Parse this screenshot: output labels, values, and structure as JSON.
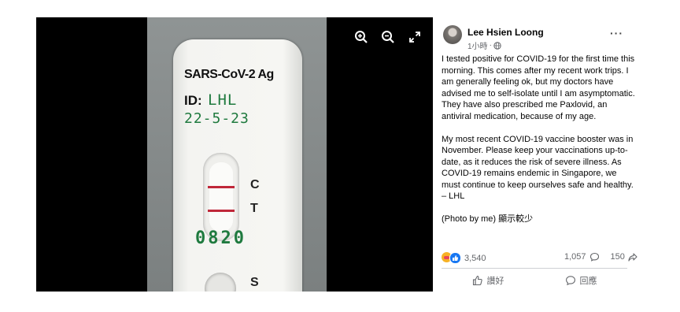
{
  "viewer": {
    "controls": [
      {
        "name": "zoom-in-icon",
        "label": "Zoom in"
      },
      {
        "name": "zoom-out-icon",
        "label": "Zoom out"
      },
      {
        "name": "fullscreen-icon",
        "label": "Full screen"
      }
    ],
    "photo": {
      "brand_text": "SARS-CoV-2 Ag",
      "id_label": "ID:",
      "id_handwritten": "LHL",
      "date_handwritten": "22-5-23",
      "marker_c": "C",
      "marker_t": "T",
      "number_handwritten": "0820",
      "marker_s": "S",
      "line_color": "#c0283a",
      "ink_color": "#1f7a3f"
    }
  },
  "post": {
    "author": "Lee Hsien Loong",
    "timestamp": "1小時",
    "privacy_icon": "globe-icon",
    "paragraphs": [
      "I tested positive for COVID-19 for the first time this morning. This comes after my recent work trips. I am generally feeling ok, but my doctors have advised me to self-isolate until I am asymptomatic. They have also prescribed me Paxlovid, an antiviral medication, because of my age.",
      "My most recent COVID-19 vaccine booster was in November. Please keep your vaccinations up-to-date, as it reduces the risk of severe illness. As COVID-19 remains endemic in Singapore, we must continue to keep ourselves safe and healthy. – LHL",
      "(Photo by me) 顯示較少"
    ],
    "reaction_count": "3,540",
    "comment_count": "1,057",
    "share_count": "150",
    "like_label": "讚好",
    "comment_label": "回應",
    "accent_color": "#1877f2"
  }
}
